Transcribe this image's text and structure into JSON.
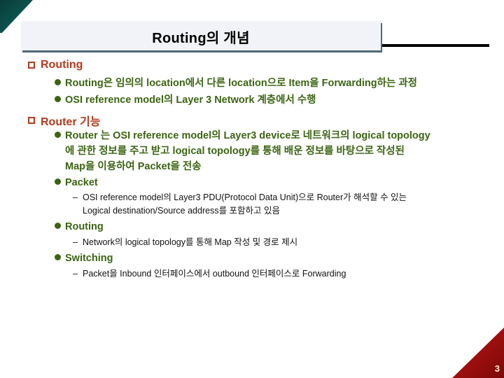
{
  "slide": {
    "title": "Routing의 개념",
    "page_number": "3",
    "colors": {
      "section_heading": "#b4391b",
      "bullet_text": "#3b6412",
      "corner_top_left": "#0d4f4a",
      "corner_bottom_right": "#a50f0f",
      "title_box_bg": "#f2f3f8",
      "title_shadow": "#4e6878"
    }
  },
  "sections": [
    {
      "icon": "checkbox-square-icon",
      "heading": "Routing",
      "bullets": [
        {
          "text": "Routing은 임의의 location에서 다른 location으로 Item을 Forwarding하는 과정"
        },
        {
          "text": "OSI reference model의 Layer 3 Network 계층에서 수행"
        }
      ]
    },
    {
      "icon": "checkbox-square-icon",
      "heading": "Router 기능",
      "bullets": [
        {
          "lines": [
            "Router 는 OSI reference model의 Layer3 device로 네트워크의 logical topology",
            "에 관한 정보를 주고 받고 logical topology를 통해 배운 정보를 바탕으로 작성된",
            "Map을 이용하여  Packet을 전송"
          ]
        },
        {
          "text": "Packet",
          "sub": {
            "dash": "–",
            "lines": [
              "OSI reference model의 Layer3 PDU(Protocol Data Unit)으로 Router가 해석할 수 있는",
              "Logical destination/Source address를 포함하고 있음"
            ]
          }
        },
        {
          "text": "Routing",
          "sub": {
            "dash": "–",
            "lines": [
              "Network의 logical topology를 통해 Map 작성 및 경로 제시"
            ]
          }
        },
        {
          "text": "Switching",
          "sub": {
            "dash": "–",
            "lines": [
              "Packet을 Inbound 인터페이스에서 outbound 인터페이스로 Forwarding"
            ]
          }
        }
      ]
    }
  ]
}
